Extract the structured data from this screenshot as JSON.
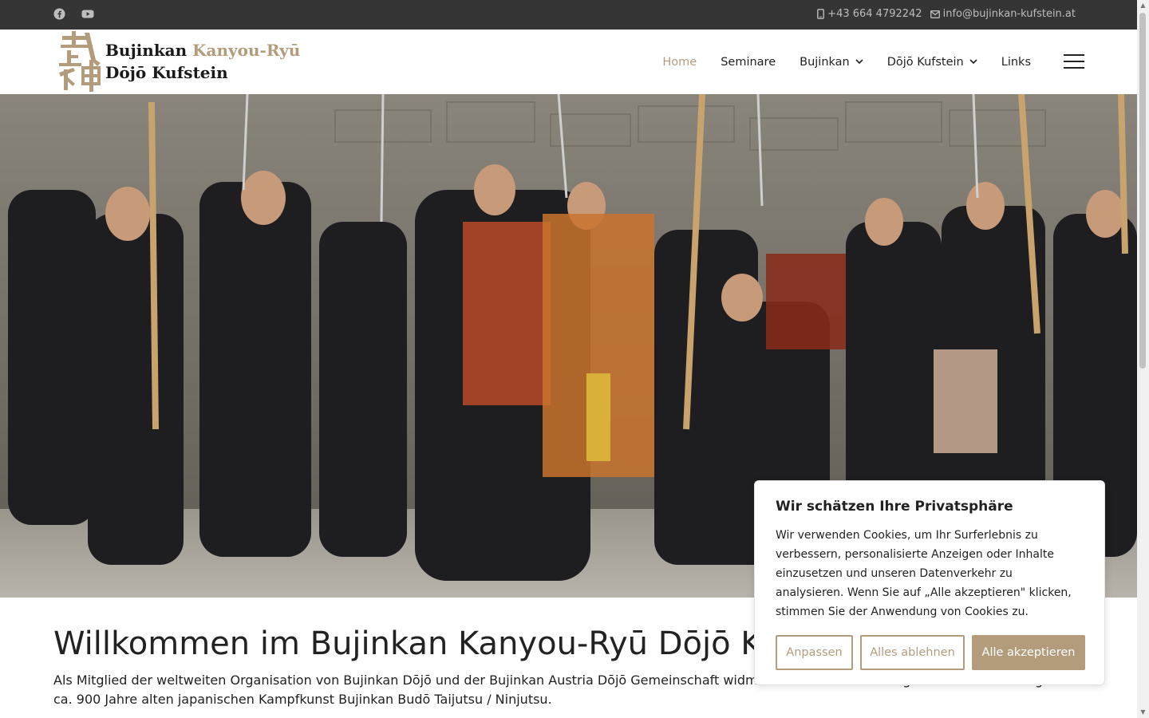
{
  "topbar": {
    "social": [
      {
        "icon": "facebook-icon"
      },
      {
        "icon": "youtube-icon"
      }
    ],
    "phone": "+43 664 4792242",
    "email": "info@bujinkan-kufstein.at"
  },
  "logo": {
    "line1_a": "Bujinkan",
    "line1_b": "Kanyou-Ryū",
    "line2": "Dōjō Kufstein"
  },
  "nav": {
    "items": [
      {
        "label": "Home",
        "active": true
      },
      {
        "label": "Seminare"
      },
      {
        "label": "Bujinkan",
        "dropdown": true
      },
      {
        "label": "Dōjō Kufstein",
        "dropdown": true
      },
      {
        "label": "Links"
      }
    ]
  },
  "content": {
    "heading": "Willkommen im Bujinkan Kanyou-Ryū Dōjō Kufstein",
    "intro": "Als Mitglied der weltweiten Organisation von Bujinkan Dōjō und der Bujinkan Austria Dōjō Gemeinschaft widmen wir uns dem Training und der Verbreitung der ca. 900 Jahre alten japanischen Kampfkunst Bujinkan Budō Taijutsu / Ninjutsu."
  },
  "cookie": {
    "title": "Wir schätzen Ihre Privatsphäre",
    "text": "Wir verwenden Cookies, um Ihr Surferlebnis zu verbessern, personalisierte Anzeigen oder Inhalte einzusetzen und unseren Datenverkehr zu analysieren. Wenn Sie auf „Alle akzeptieren\" klicken, stimmen Sie der Anwendung von Cookies zu.",
    "customize": "Anpassen",
    "reject": "Alles ablehnen",
    "accept": "Alle akzeptieren"
  },
  "colors": {
    "accent": "#b39c7c",
    "topbar": "#353535"
  }
}
